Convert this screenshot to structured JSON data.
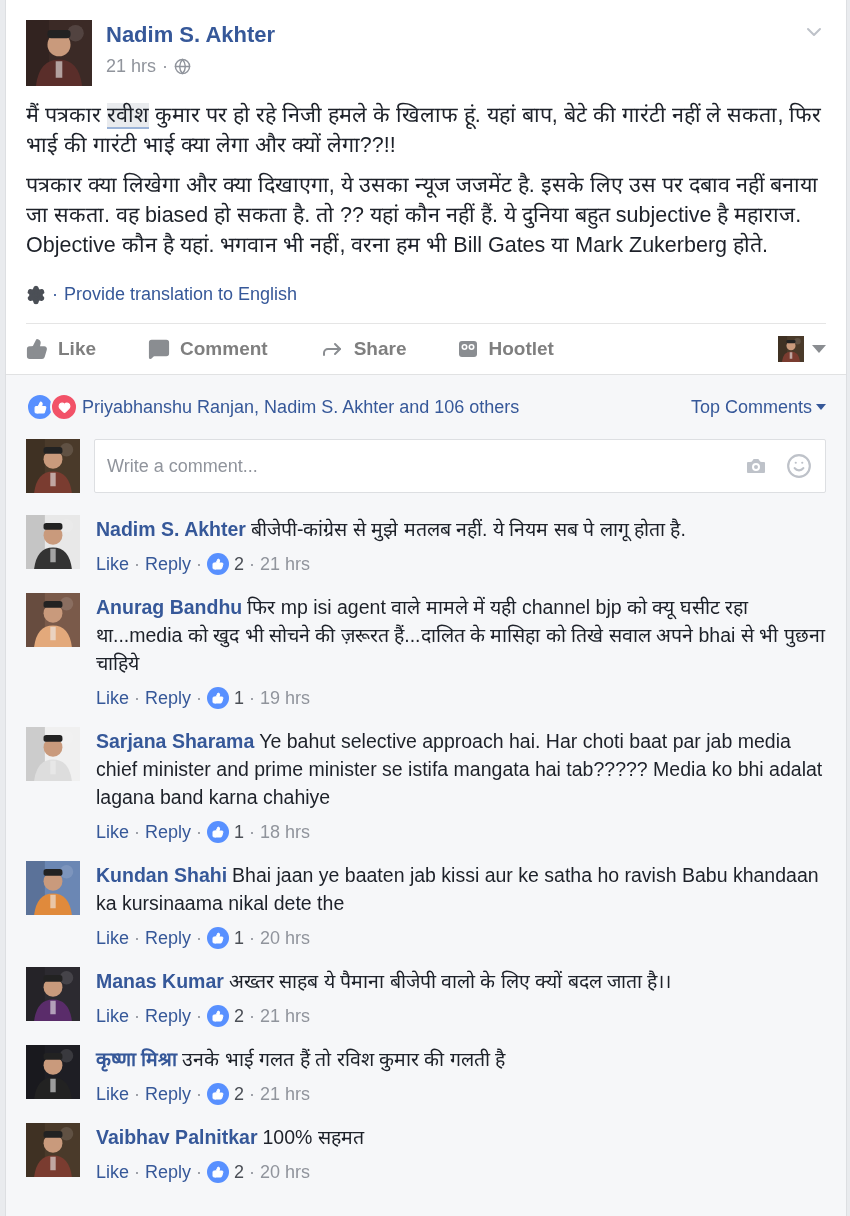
{
  "post": {
    "author": "Nadim S. Akhter",
    "time": "21 hrs",
    "time_separator": "·",
    "translation_separator": "·",
    "paragraphs": [
      {
        "parts": [
          {
            "kind": "text",
            "text": "मैं पत्रकार "
          },
          {
            "kind": "mention",
            "text": "रवीश"
          },
          {
            "kind": "text",
            "text": " कुमार पर हो रहे निजी हमले के खिलाफ हूं. यहां बाप, बेटे की गारंटी नहीं ले सकता, फिर भाई की गारंटी भाई क्या लेगा और क्यों लेगा??!!"
          }
        ]
      },
      {
        "parts": [
          {
            "kind": "text",
            "text": "पत्रकार क्या लिखेगा और क्या दिखाएगा, ये उसका न्यूज जजमेंट है. इसके लिए उस पर दबाव नहीं बनाया जा सकता. वह biased हो सकता है. तो ?? यहां कौन नहीं हैं. ये दुनिया बहुत subjective है महाराज. Objective कौन है यहां. भगवान भी नहीं, वरना हम भी Bill Gates या Mark Zukerberg होते."
          }
        ]
      }
    ],
    "translation_link": "Provide translation to English"
  },
  "actions": [
    {
      "kind": "like",
      "label": "Like"
    },
    {
      "kind": "comment",
      "label": "Comment"
    },
    {
      "kind": "share",
      "label": "Share"
    },
    {
      "kind": "hootlet",
      "label": "Hootlet"
    }
  ],
  "reactions": {
    "text": "Priyabhanshu Ranjan, Nadim S. Akhter and 106 others",
    "sort": "Top Comments"
  },
  "comment_box": {
    "placeholder": "Write a comment..."
  },
  "comments": [
    {
      "author": "Nadim S. Akhter",
      "text": "बीजेपी-कांग्रेस से मुझे मतलब नहीं. ये नियम सब पे लागू होता है.",
      "like": "Like",
      "reply": "Reply",
      "likes": "2",
      "time": "21 hrs",
      "separators": [
        "·",
        "·",
        "·"
      ]
    },
    {
      "author": "Anurag Bandhu",
      "text": "फिर mp isi agent वाले मामले में यही channel bjp को क्यू घसीट रहा था...media को खुद भी सोचने की ज़रूरत हैं...दालित के मासिहा को तिखे सवाल अपने bhai से भी पुछना चाहिये",
      "like": "Like",
      "reply": "Reply",
      "likes": "1",
      "time": "19 hrs",
      "separators": [
        "·",
        "·",
        "·"
      ]
    },
    {
      "author": "Sarjana Sharama",
      "text": "Ye bahut selective approach hai. Har choti baat par jab media chief minister and prime minister se istifa mangata hai tab????? Media ko bhi adalat lagana band karna chahiye",
      "like": "Like",
      "reply": "Reply",
      "likes": "1",
      "time": "18 hrs",
      "separators": [
        "·",
        "·",
        "·"
      ]
    },
    {
      "author": "Kundan Shahi",
      "text": "Bhai jaan ye baaten jab kissi aur ke satha ho ravish Babu khandaan ka kursinaama nikal dete the",
      "like": "Like",
      "reply": "Reply",
      "likes": "1",
      "time": "20 hrs",
      "separators": [
        "·",
        "·",
        "·"
      ]
    },
    {
      "author": "Manas Kumar",
      "text": "अख्तर साहब ये पैमाना बीजेपी वालो के लिए क्यों बदल जाता है।।",
      "like": "Like",
      "reply": "Reply",
      "likes": "2",
      "time": "21 hrs",
      "separators": [
        "·",
        "·",
        "·"
      ]
    },
    {
      "author": "कृष्णा मिश्रा",
      "text": "उनके भाई गलत हैं तो रविश कुमार की गलती है",
      "like": "Like",
      "reply": "Reply",
      "likes": "2",
      "time": "21 hrs",
      "separators": [
        "·",
        "·",
        "·"
      ]
    },
    {
      "author": "Vaibhav Palnitkar",
      "text": "100% सहमत",
      "like": "Like",
      "reply": "Reply",
      "likes": "2",
      "time": "20 hrs",
      "separators": [
        "·",
        "·",
        "·"
      ]
    }
  ]
}
